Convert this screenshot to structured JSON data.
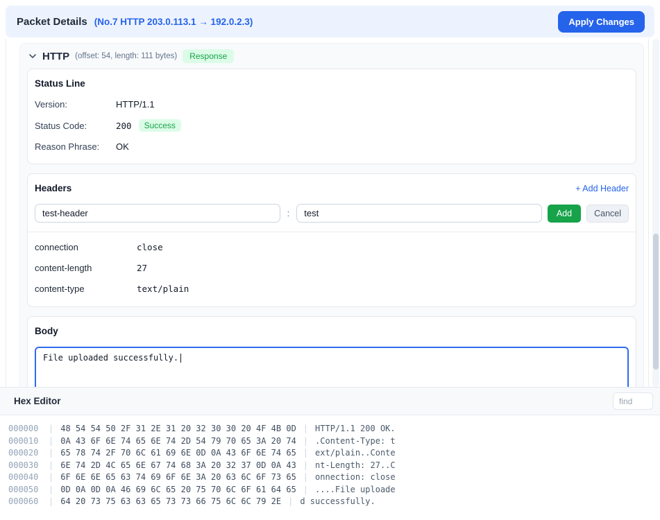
{
  "header": {
    "title": "Packet Details",
    "subtitle": "(No.7 HTTP 203.0.113.1 → 192.0.2.3)",
    "apply_label": "Apply Changes"
  },
  "http_section": {
    "title": "HTTP",
    "meta": "(offset: 54, length: 111 bytes)",
    "badge": "Response"
  },
  "status_line": {
    "title": "Status Line",
    "version_label": "Version:",
    "version_value": "HTTP/1.1",
    "code_label": "Status Code:",
    "code_value": "200",
    "code_badge": "Success",
    "reason_label": "Reason Phrase:",
    "reason_value": "OK"
  },
  "headers_card": {
    "title": "Headers",
    "add_link": "+ Add Header",
    "name_value": "test-header",
    "separator": ":",
    "value_value": "test",
    "add_button": "Add",
    "cancel_button": "Cancel",
    "rows": [
      {
        "name": "connection",
        "value": "close"
      },
      {
        "name": "content-length",
        "value": "27"
      },
      {
        "name": "content-type",
        "value": "text/plain"
      }
    ]
  },
  "body_card": {
    "title": "Body",
    "content": "File uploaded successfully."
  },
  "hex_editor": {
    "title": "Hex Editor",
    "find_placeholder": "find",
    "separator": "|",
    "rows": [
      {
        "offset": "000000",
        "bytes": "48 54 54 50 2F 31 2E 31 20 32 30 30 20 4F 4B 0D",
        "ascii": "HTTP/1.1 200 OK."
      },
      {
        "offset": "000010",
        "bytes": "0A 43 6F 6E 74 65 6E 74 2D 54 79 70 65 3A 20 74",
        "ascii": ".Content-Type: t"
      },
      {
        "offset": "000020",
        "bytes": "65 78 74 2F 70 6C 61 69 6E 0D 0A 43 6F 6E 74 65",
        "ascii": "ext/plain..Conte"
      },
      {
        "offset": "000030",
        "bytes": "6E 74 2D 4C 65 6E 67 74 68 3A 20 32 37 0D 0A 43",
        "ascii": "nt-Length: 27..C"
      },
      {
        "offset": "000040",
        "bytes": "6F 6E 6E 65 63 74 69 6F 6E 3A 20 63 6C 6F 73 65",
        "ascii": "onnection: close"
      },
      {
        "offset": "000050",
        "bytes": "0D 0A 0D 0A 46 69 6C 65 20 75 70 6C 6F 61 64 65",
        "ascii": "....File uploade"
      },
      {
        "offset": "000060",
        "bytes": "64 20 73 75 63 63 65 73 73 66 75 6C 6C 79 2E",
        "ascii": "d successfully."
      }
    ]
  },
  "colors": {
    "accent": "#2563eb",
    "success": "#16a34a",
    "success_bg": "#dcfce7",
    "topbar_bg": "#edf3fe",
    "section_bg": "#f8fafc"
  }
}
